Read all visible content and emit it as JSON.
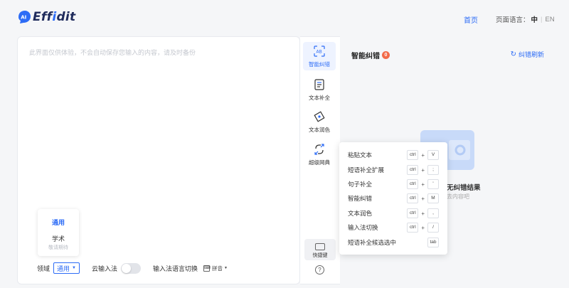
{
  "header": {
    "logo_mark": "AI",
    "logo_text_a": "Eff",
    "logo_text_i": "i",
    "logo_text_b": "dit",
    "nav_home": "首页",
    "lang_label": "页面语言：",
    "lang_zh": "中",
    "lang_en": "EN"
  },
  "editor": {
    "placeholder": "此界面仅供体验，不会自动保存您输入的内容，请及时备份",
    "domain_options": [
      {
        "label": "通用"
      },
      {
        "label": "学术",
        "sub": "敬请期待"
      }
    ],
    "bottom": {
      "domain_label": "领域",
      "domain_value": "通用",
      "cloud_ime_label": "云输入法",
      "cloud_ime_on": false,
      "ime_lang_label": "输入法语言切换",
      "ime_lang_value": "拼音"
    }
  },
  "tools": [
    {
      "label": "智能纠错",
      "active": true
    },
    {
      "label": "文本补全",
      "active": false
    },
    {
      "label": "文本润色",
      "active": false
    },
    {
      "label": "超级网典",
      "active": false
    }
  ],
  "toolbar_bottom": {
    "shortcut_label": "快捷键",
    "help_glyph": "?"
  },
  "right_panel": {
    "title": "智能纠错",
    "badge": "0",
    "refresh_label": "纠错刷新",
    "empty_title": "无纠错结果",
    "empty_sub": "去内容吧"
  },
  "shortcuts": [
    {
      "name": "粘贴文本",
      "keys": [
        "ctrl",
        "V"
      ]
    },
    {
      "name": "短语补全扩展",
      "keys": [
        "ctrl",
        ";"
      ]
    },
    {
      "name": "句子补全",
      "keys": [
        "ctrl",
        "'"
      ]
    },
    {
      "name": "智能纠错",
      "keys": [
        "ctrl",
        "M"
      ]
    },
    {
      "name": "文本润色",
      "keys": [
        "ctrl",
        ","
      ]
    },
    {
      "name": "输入法切换",
      "keys": [
        "ctrl",
        "/"
      ]
    },
    {
      "name": "短语补全候选选中",
      "keys": [
        "tab"
      ]
    }
  ],
  "colors": {
    "accent": "#2d6cf6",
    "badge": "#f26b4a",
    "brand_dark": "#1f2b5c"
  }
}
